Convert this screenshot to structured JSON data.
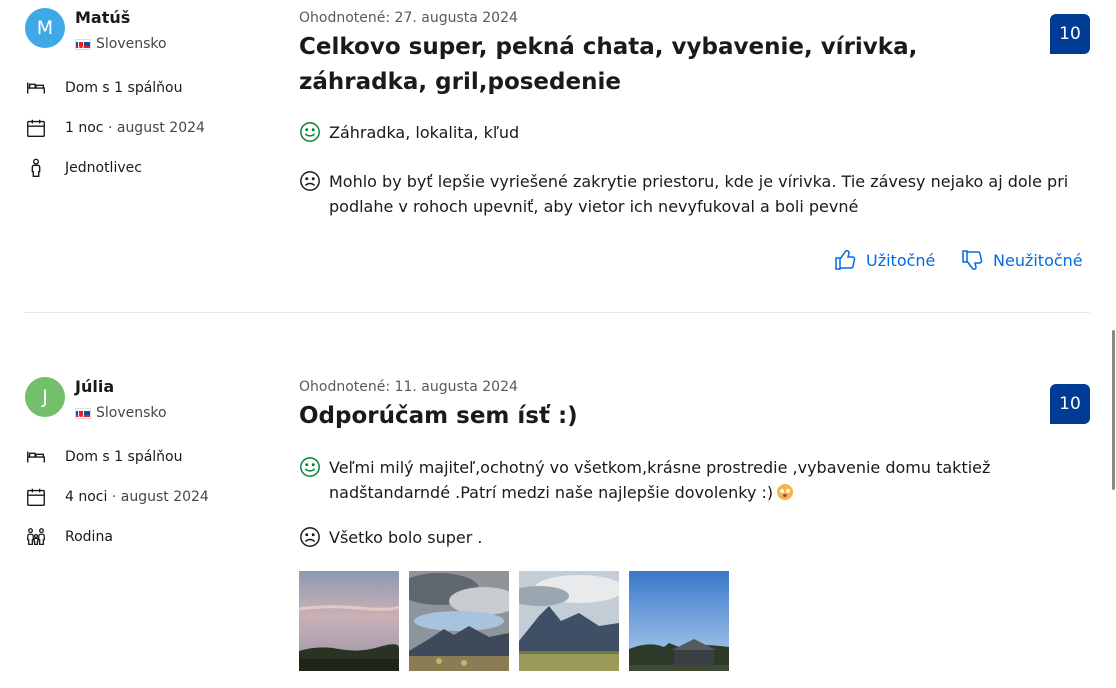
{
  "reviews": [
    {
      "reviewer_initial": "M",
      "avatar_color": "#3fa9e8",
      "reviewer_name": "Matúš",
      "country": "Slovensko",
      "room_type": "Dom s 1 spálňou",
      "stay_nights": "1 noc",
      "stay_date": "august 2024",
      "traveler_type": "Jednotlivec",
      "traveler_icon": "person-icon",
      "reviewed_date": "Ohodnotené: 27. augusta 2024",
      "title": "Celkovo super, pekná chata, vybavenie, vírivka, záhradka, gril,posedenie",
      "score": "10",
      "positive": "Záhradka, lokalita, kľud",
      "negative": "Mohlo by byť lepšie vyriešené zakrytie priestoru, kde je vírivka. Tie závesy nejako aj dole pri podlahe v rohoch upevniť, aby vietor ich nevyfukoval a boli pevné",
      "helpful_label": "Užitočné",
      "not_helpful_label": "Neužitočné"
    },
    {
      "reviewer_initial": "J",
      "avatar_color": "#73bf6b",
      "reviewer_name": "Júlia",
      "country": "Slovensko",
      "room_type": "Dom s 1 spálňou",
      "stay_nights": "4 noci",
      "stay_date": "august 2024",
      "traveler_type": "Rodina",
      "traveler_icon": "family-icon",
      "reviewed_date": "Ohodnotené: 11. augusta 2024",
      "title": "Odporúčam sem ísť :)",
      "score": "10",
      "positive": "Veľmi milý majiteľ,ochotný vo všetkom,krásne prostredie ,vybavenie domu taktiež nadštandarndé .Patrí medzi naše najlepšie dovolenky :)",
      "negative": "Všetko bolo super .",
      "photos": [
        "sunset-photo",
        "clouds-mountains-photo",
        "mountain-field-photo",
        "blue-sky-house-photo"
      ]
    }
  ],
  "colors": {
    "accent": "#006ce4",
    "score_bg": "#003b95",
    "positive_icon": "#008234"
  }
}
